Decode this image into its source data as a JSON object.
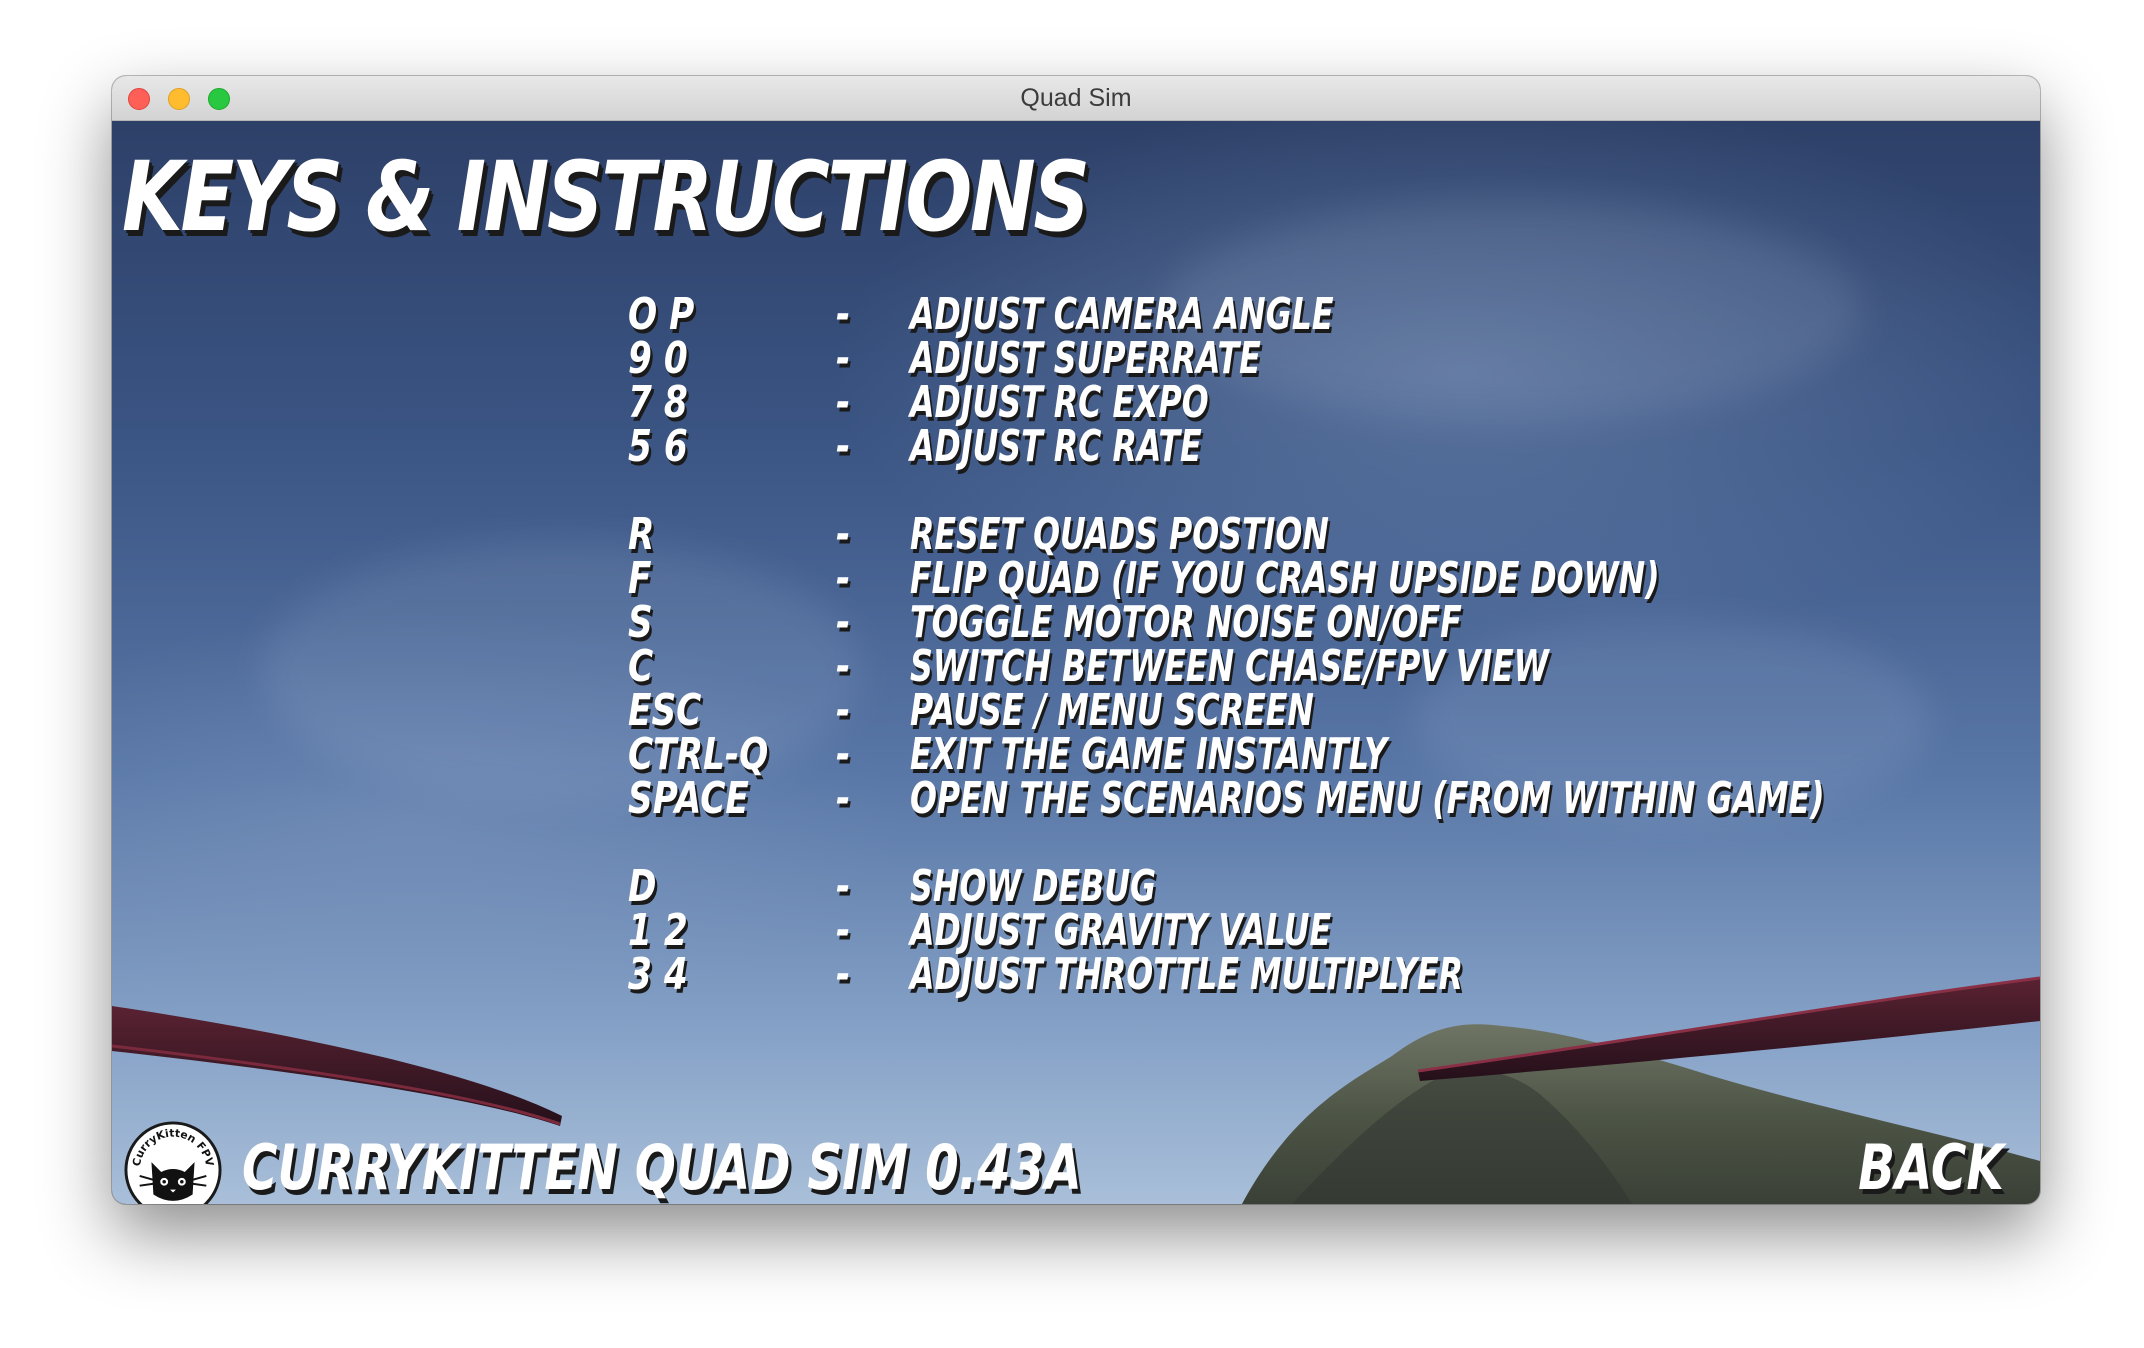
{
  "window": {
    "title": "Quad Sim"
  },
  "screen": {
    "heading": "KEYS & INSTRUCTIONS",
    "key_groups": [
      [
        {
          "keys": "O  P",
          "separator": "-",
          "action": "ADJUST CAMERA ANGLE"
        },
        {
          "keys": "9  0",
          "separator": "-",
          "action": "ADJUST SUPERRATE"
        },
        {
          "keys": "7  8",
          "separator": "-",
          "action": "ADJUST RC EXPO"
        },
        {
          "keys": "5  6",
          "separator": "-",
          "action": "ADJUST RC RATE"
        }
      ],
      [
        {
          "keys": "R",
          "separator": "-",
          "action": "RESET QUADS POSTION"
        },
        {
          "keys": "F",
          "separator": "-",
          "action": "FLIP QUAD (IF YOU CRASH UPSIDE DOWN)"
        },
        {
          "keys": "S",
          "separator": "-",
          "action": "TOGGLE MOTOR NOISE ON/OFF"
        },
        {
          "keys": "C",
          "separator": "-",
          "action": "SWITCH BETWEEN CHASE/FPV VIEW"
        },
        {
          "keys": "ESC",
          "separator": "-",
          "action": "PAUSE / MENU SCREEN"
        },
        {
          "keys": "CTRL-Q",
          "separator": "-",
          "action": "EXIT THE GAME INSTANTLY"
        },
        {
          "keys": "SPACE",
          "separator": "-",
          "action": "OPEN THE SCENARIOS MENU (FROM WITHIN GAME)"
        }
      ],
      [
        {
          "keys": "D",
          "separator": "-",
          "action": "SHOW DEBUG"
        },
        {
          "keys": "1  2",
          "separator": "-",
          "action": "ADJUST GRAVITY VALUE"
        },
        {
          "keys": "3  4",
          "separator": "-",
          "action": "ADJUST THROTTLE MULTIPLYER"
        }
      ]
    ],
    "footer_title": "CURRYKITTEN QUAD SIM 0.43A",
    "logo_text": "CurryKitten FPV",
    "back_label": "BACK"
  },
  "icons": {
    "logo": "cat-logo-icon"
  },
  "colors": {
    "sky_top": "#2d4068",
    "sky_bottom": "#a9bfd9",
    "text": "#ffffff",
    "text_shadow": "#1a1a1a",
    "prop_blade": "#3a1622"
  }
}
